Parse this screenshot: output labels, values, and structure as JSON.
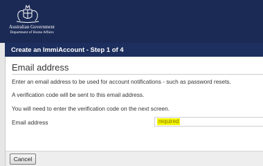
{
  "header": {
    "gov_name_line1": "Australian Government",
    "gov_name_line2": "Department of Home Affairs",
    "crest_icon": "coat-of-arms-icon"
  },
  "step_bar": {
    "title": "Create an ImmiAccount - Step 1 of 4"
  },
  "section": {
    "title": "Email address",
    "paragraphs": [
      "Enter an email address to be used for account notifications - such as password resets.",
      "A verification code will be sent to this email address.",
      "You will need to enter the verification code on the next screen."
    ]
  },
  "form": {
    "email_label": "Email address",
    "email_value": "",
    "required_text": "required"
  },
  "footer": {
    "cancel_label": "Cancel"
  },
  "colors": {
    "header_bg": "#1b2a55",
    "step_bar_bg": "#1d2f5e",
    "required_highlight": "#f3f500"
  }
}
